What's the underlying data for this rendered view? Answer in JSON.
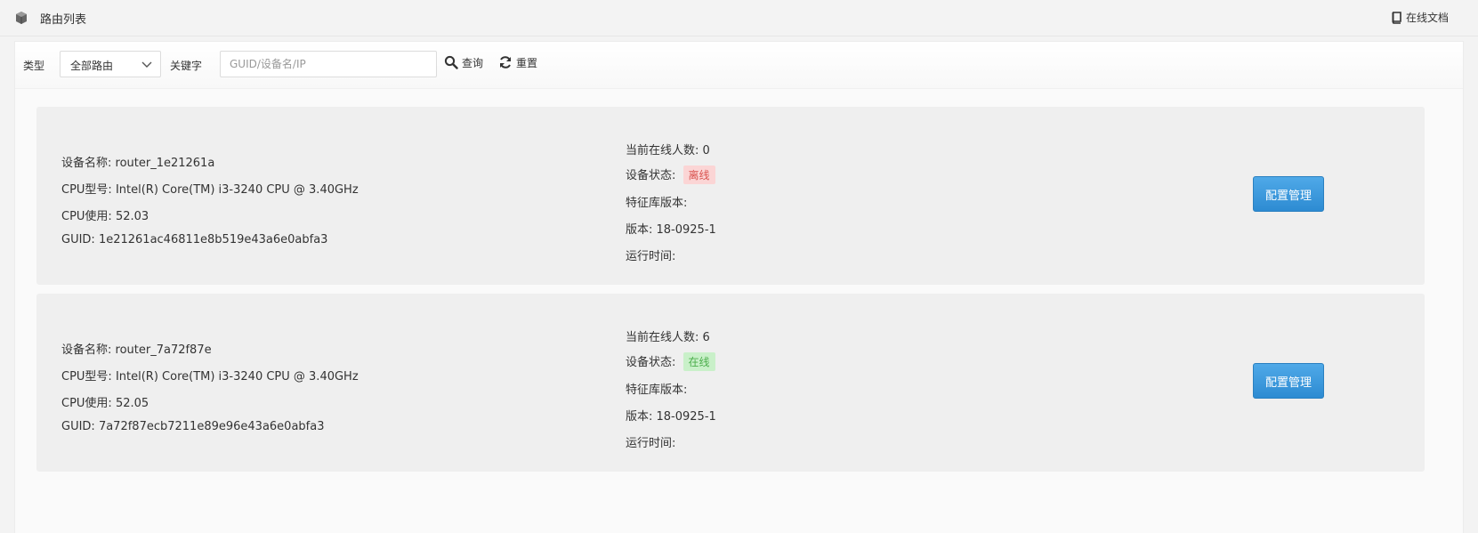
{
  "header": {
    "title": "路由列表",
    "doc_label": "在线文档"
  },
  "filter": {
    "type_label": "类型",
    "type_value": "全部路由",
    "keyword_label": "关键字",
    "keyword_placeholder": "GUID/设备名/IP",
    "keyword_value": "",
    "search_label": "查询",
    "reset_label": "重置"
  },
  "devices": [
    {
      "name": "设备名称: router_1e21261a",
      "cpu_model": "CPU型号: Intel(R) Core(TM) i3-3240 CPU @ 3.40GHz",
      "cpu_usage": "CPU使用: 52.03",
      "guid": "GUID: 1e21261ac46811e8b519e43a6e0abfa3",
      "online_users": "当前在线人数: 0",
      "status_label": "设备状态:",
      "status_value": "离线",
      "status": "offline",
      "feature_version": "特征库版本:",
      "version": "版本: 18-0925-1",
      "uptime": "运行时间:",
      "button": "配置管理"
    },
    {
      "name": "设备名称: router_7a72f87e",
      "cpu_model": "CPU型号: Intel(R) Core(TM) i3-3240 CPU @ 3.40GHz",
      "cpu_usage": "CPU使用: 52.05",
      "guid": "GUID: 7a72f87ecb7211e89e96e43a6e0abfa3",
      "online_users": "当前在线人数: 6",
      "status_label": "设备状态:",
      "status_value": "在线",
      "status": "online",
      "feature_version": "特征库版本:",
      "version": "版本: 18-0925-1",
      "uptime": "运行时间:",
      "button": "配置管理"
    }
  ],
  "colors": {
    "primary_button": "#3a9ad9",
    "offline_bg": "#fbd5d5",
    "offline_text": "#d9534f",
    "online_bg": "#c9f0c9",
    "online_text": "#4cae4c"
  },
  "icons": {
    "header": "cube-icon",
    "doc": "book-icon",
    "search": "search-icon",
    "reset": "refresh-icon",
    "select": "chevron-down-icon"
  }
}
